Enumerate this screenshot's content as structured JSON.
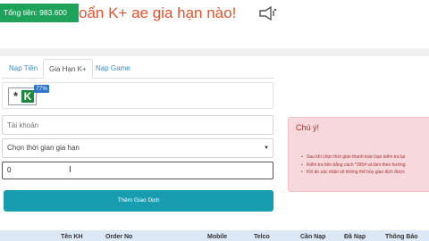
{
  "header": {
    "balance_label": "Tổng tiền: 983.600",
    "marquee": "oẩn K+ ae gia hạn nào!",
    "colors": {
      "balance_bg": "#1fa35a",
      "marquee": "#e4532e"
    }
  },
  "tabs": [
    {
      "label": "Nạp Tiền"
    },
    {
      "label": "Gia Hạn K+",
      "active": true
    },
    {
      "label": "Nạp Game"
    }
  ],
  "service": {
    "logo_letter": "K",
    "logo_plus": "+",
    "discount": "77%"
  },
  "form": {
    "account_placeholder": "Tài khoản",
    "duration_selected": "Chọn thời gian gia hạn",
    "amount_value": "0",
    "submit_label": "Thêm Giao Dịch"
  },
  "notice": {
    "title": "Chú ý!",
    "items": [
      "Sau khi chọn thời gian thanh toán bạn kiểm tra lại",
      "Kiểm tra tiền bằng cách *395# và làm theo hướng",
      "Khi ấn xác nhận sẽ không thể hủy giao dịch được"
    ],
    "colors": {
      "bg": "#f7d8dc",
      "text": "#a33333"
    }
  },
  "table": {
    "headers": [
      "Tên KH",
      "Order No",
      "Mobile",
      "Telco",
      "Cần Nạp",
      "Đã Nạp",
      "Thông Báo"
    ]
  },
  "icons": {
    "speaker": "megaphone-icon",
    "caret": "caret-down-icon"
  }
}
